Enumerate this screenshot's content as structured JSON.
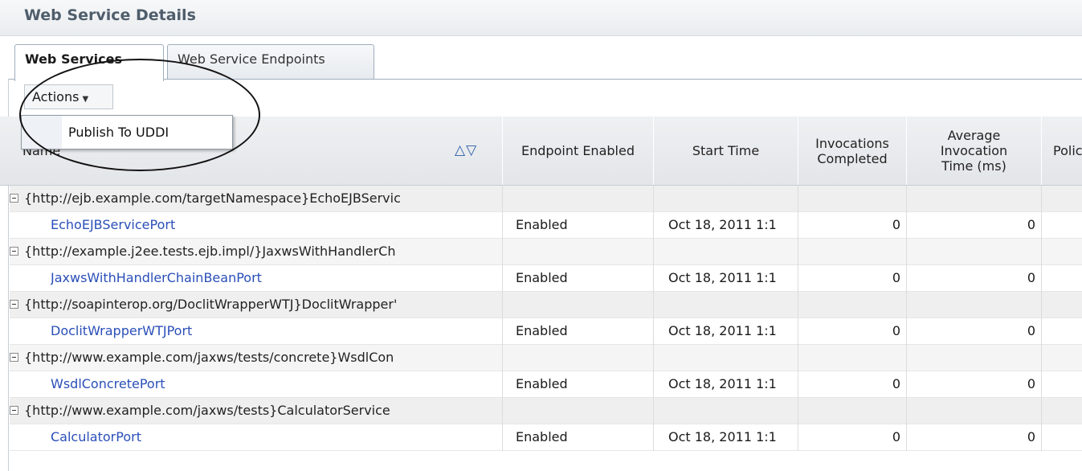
{
  "panel": {
    "title": "Web Service Details"
  },
  "tabs": [
    {
      "label": "Web Services"
    },
    {
      "label": "Web Service Endpoints"
    }
  ],
  "toolbar": {
    "actions_label": "Actions"
  },
  "actions_menu": {
    "items": [
      {
        "label": "Publish To UDDI"
      }
    ]
  },
  "table": {
    "headers": {
      "name": "Name",
      "endpoint_enabled": "Endpoint Enabled",
      "start_time": "Start Time",
      "invocations_completed": "Invocations Completed",
      "avg_invocation_time": "Average Invocation Time (ms)",
      "policies": "Polic"
    },
    "rows": [
      {
        "group": "{http://ejb.example.com/targetNamespace}EchoEJBServic",
        "port": "EchoEJBServicePort",
        "enabled": "Enabled",
        "start": "Oct 18, 2011 1:1",
        "completed": "0",
        "avg": "0"
      },
      {
        "group": "{http://example.j2ee.tests.ejb.impl/}JaxwsWithHandlerCh",
        "port": "JaxwsWithHandlerChainBeanPort",
        "enabled": "Enabled",
        "start": "Oct 18, 2011 1:1",
        "completed": "0",
        "avg": "0"
      },
      {
        "group": "{http://soapinterop.org/DoclitWrapperWTJ}DoclitWrapper'",
        "port": "DoclitWrapperWTJPort",
        "enabled": "Enabled",
        "start": "Oct 18, 2011 1:1",
        "completed": "0",
        "avg": "0"
      },
      {
        "group": "{http://www.example.com/jaxws/tests/concrete}WsdlCon",
        "port": "WsdlConcretePort",
        "enabled": "Enabled",
        "start": "Oct 18, 2011 1:1",
        "completed": "0",
        "avg": "0"
      },
      {
        "group": "{http://www.example.com/jaxws/tests}CalculatorService",
        "port": "CalculatorPort",
        "enabled": "Enabled",
        "start": "Oct 18, 2011 1:1",
        "completed": "0",
        "avg": "0"
      }
    ]
  },
  "colors": {
    "link": "#2a4fb8",
    "sort_icon": "#2b5aa8",
    "title": "#4f5d6b"
  },
  "icons": {
    "sort": "sort-up-down-icon",
    "collapse": "collapse-minus-icon",
    "caret": "caret-down-icon"
  }
}
